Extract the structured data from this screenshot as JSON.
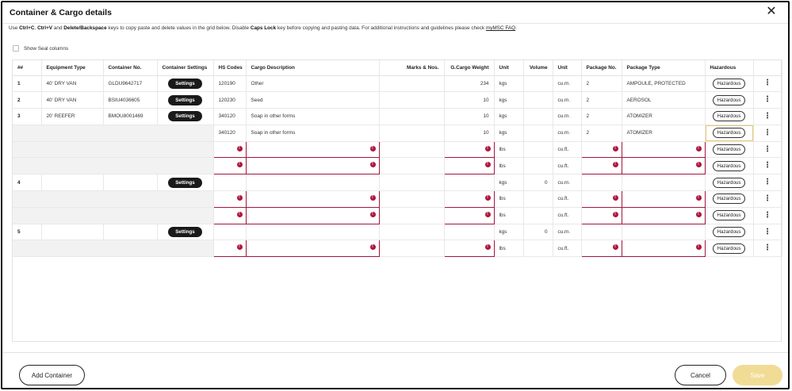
{
  "dialog": {
    "title": "Container & Cargo details",
    "close_glyph": "✕",
    "instructions": {
      "p1": "Use ",
      "k1": "Ctrl+C",
      "p2": ", ",
      "k2": "Ctrl+V",
      "p3": " and ",
      "k3": "Delete/Backspace",
      "p4": " keys to copy paste and delete values in the grid below. Disable ",
      "k4": "Caps Lock",
      "p5": " key before copying and pasting data. For additional instructions and guidelines please check ",
      "link": "myMSC FAQ",
      "p6": "."
    },
    "seal_label": "Show Seal columns"
  },
  "grid": {
    "headers": {
      "num": "##",
      "equipment": "Equipment Type",
      "container": "Container No.",
      "settings": "Container Settings",
      "hs": "HS Codes",
      "cargo": "Cargo Description",
      "marks": "Marks & Nos.",
      "weight": "G.Cargo Weight",
      "unit1": "Unit",
      "volume": "Volume",
      "unit2": "Unit",
      "pkgno": "Package No.",
      "pkgtype": "Package Type",
      "haz": "Hazardous"
    },
    "settings_label": "Settings",
    "haz_label": "Hazardous",
    "kebab": "⋮",
    "rows": [
      {
        "num": "1",
        "equipment": "40' DRY VAN",
        "container": "GLDU9642717",
        "hs": "120190",
        "cargo": "Other",
        "weight": "234",
        "unit1": "kgs",
        "volume": "",
        "unit2": "cu.m.",
        "pkgno": "2",
        "pkgtype": "AMPOULE, PROTECTED"
      },
      {
        "num": "2",
        "equipment": "40' DRY VAN",
        "container": "BSIU4036605",
        "hs": "120230",
        "cargo": "Seed",
        "weight": "10",
        "unit1": "kgs",
        "volume": "",
        "unit2": "cu.m.",
        "pkgno": "2",
        "pkgtype": "AEROSOL"
      },
      {
        "num": "3",
        "equipment": "20' REEFER",
        "container": "BMOU8001469",
        "hs": "340120",
        "cargo": "Soap in other forms",
        "weight": "10",
        "unit1": "kgs",
        "volume": "",
        "unit2": "cu.m.",
        "pkgno": "2",
        "pkgtype": "ATOMIZER"
      },
      {
        "hs": "340120",
        "cargo": "Soap in other forms",
        "weight": "10",
        "unit1": "kgs",
        "unit2": "cu.m.",
        "pkgno": "2",
        "pkgtype": "ATOMIZER"
      },
      {
        "unit1": "lbs",
        "unit2": "cu.ft."
      },
      {
        "unit1": "lbs",
        "unit2": "cu.ft."
      },
      {
        "num": "4",
        "unit1": "kgs",
        "volume": "0",
        "unit2": "cu.m."
      },
      {
        "unit1": "lbs",
        "unit2": "cu.ft."
      },
      {
        "unit1": "lbs",
        "unit2": "cu.ft."
      },
      {
        "num": "5",
        "unit1": "kgs",
        "volume": "0",
        "unit2": "cu.m."
      },
      {
        "unit1": "lbs",
        "unit2": "cu.ft."
      }
    ]
  },
  "footer": {
    "add_container": "Add Container",
    "cancel": "Cancel",
    "save": "Save"
  },
  "colors": {
    "error_border": "#a1173d",
    "save_disabled": "#f1dc96"
  }
}
